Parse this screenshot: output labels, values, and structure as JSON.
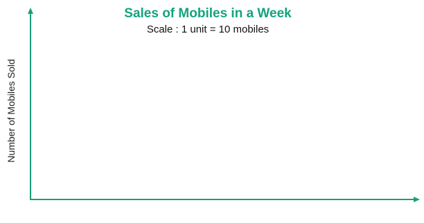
{
  "chart_data": {
    "type": "bar",
    "title": "Sales of Mobiles in a Week",
    "subtitle": "Scale : 1 unit = 10 mobiles",
    "xlabel": "",
    "ylabel": "Number of Mobiles Sold",
    "categories": [],
    "values": [],
    "grid": false,
    "legend": "none"
  },
  "colors": {
    "title": "#13a37f",
    "axis": "#1a9e7b"
  }
}
